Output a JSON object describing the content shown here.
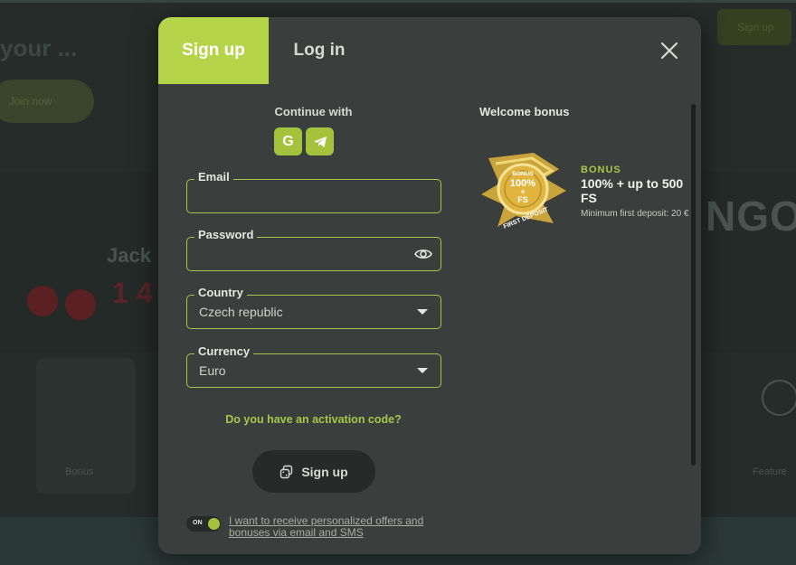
{
  "background": {
    "hero_text": "your ...",
    "hero_button": "Join now",
    "header_signup": "Sign up",
    "banner_title": "Jack",
    "banner_number": "1 4",
    "right_word": "NGO",
    "card_left_label": "Bonus",
    "card_right_label": "Feature"
  },
  "tabs": {
    "signup": "Sign up",
    "login": "Log in"
  },
  "form": {
    "continue_with": "Continue with",
    "social": [
      {
        "name": "google",
        "glyph": "G"
      },
      {
        "name": "telegram"
      }
    ],
    "email": {
      "label": "Email",
      "value": ""
    },
    "password": {
      "label": "Password",
      "value": ""
    },
    "country": {
      "label": "Country",
      "value": "Czech republic"
    },
    "currency": {
      "label": "Currency",
      "value": "Euro"
    },
    "activation_link": "Do you have an activation code?",
    "submit_label": "Sign up",
    "toggle_state": "ON",
    "consent_text": "I want to receive personalized offers and bonuses via email and SMS"
  },
  "welcome": {
    "title": "Welcome bonus",
    "badge_line1": "BONUS",
    "badge_line2": "100%",
    "badge_line3": "+",
    "badge_line4": "FS",
    "badge_ribbon": "FIRST DEPOSIT",
    "tag": "BONUS",
    "headline": "100% + up to 500 FS",
    "min_deposit": "Minimum first deposit: 20 €"
  },
  "colors": {
    "accent": "#b5d44a",
    "modal_bg": "#3a3f3d",
    "button_dark": "#262a29"
  }
}
